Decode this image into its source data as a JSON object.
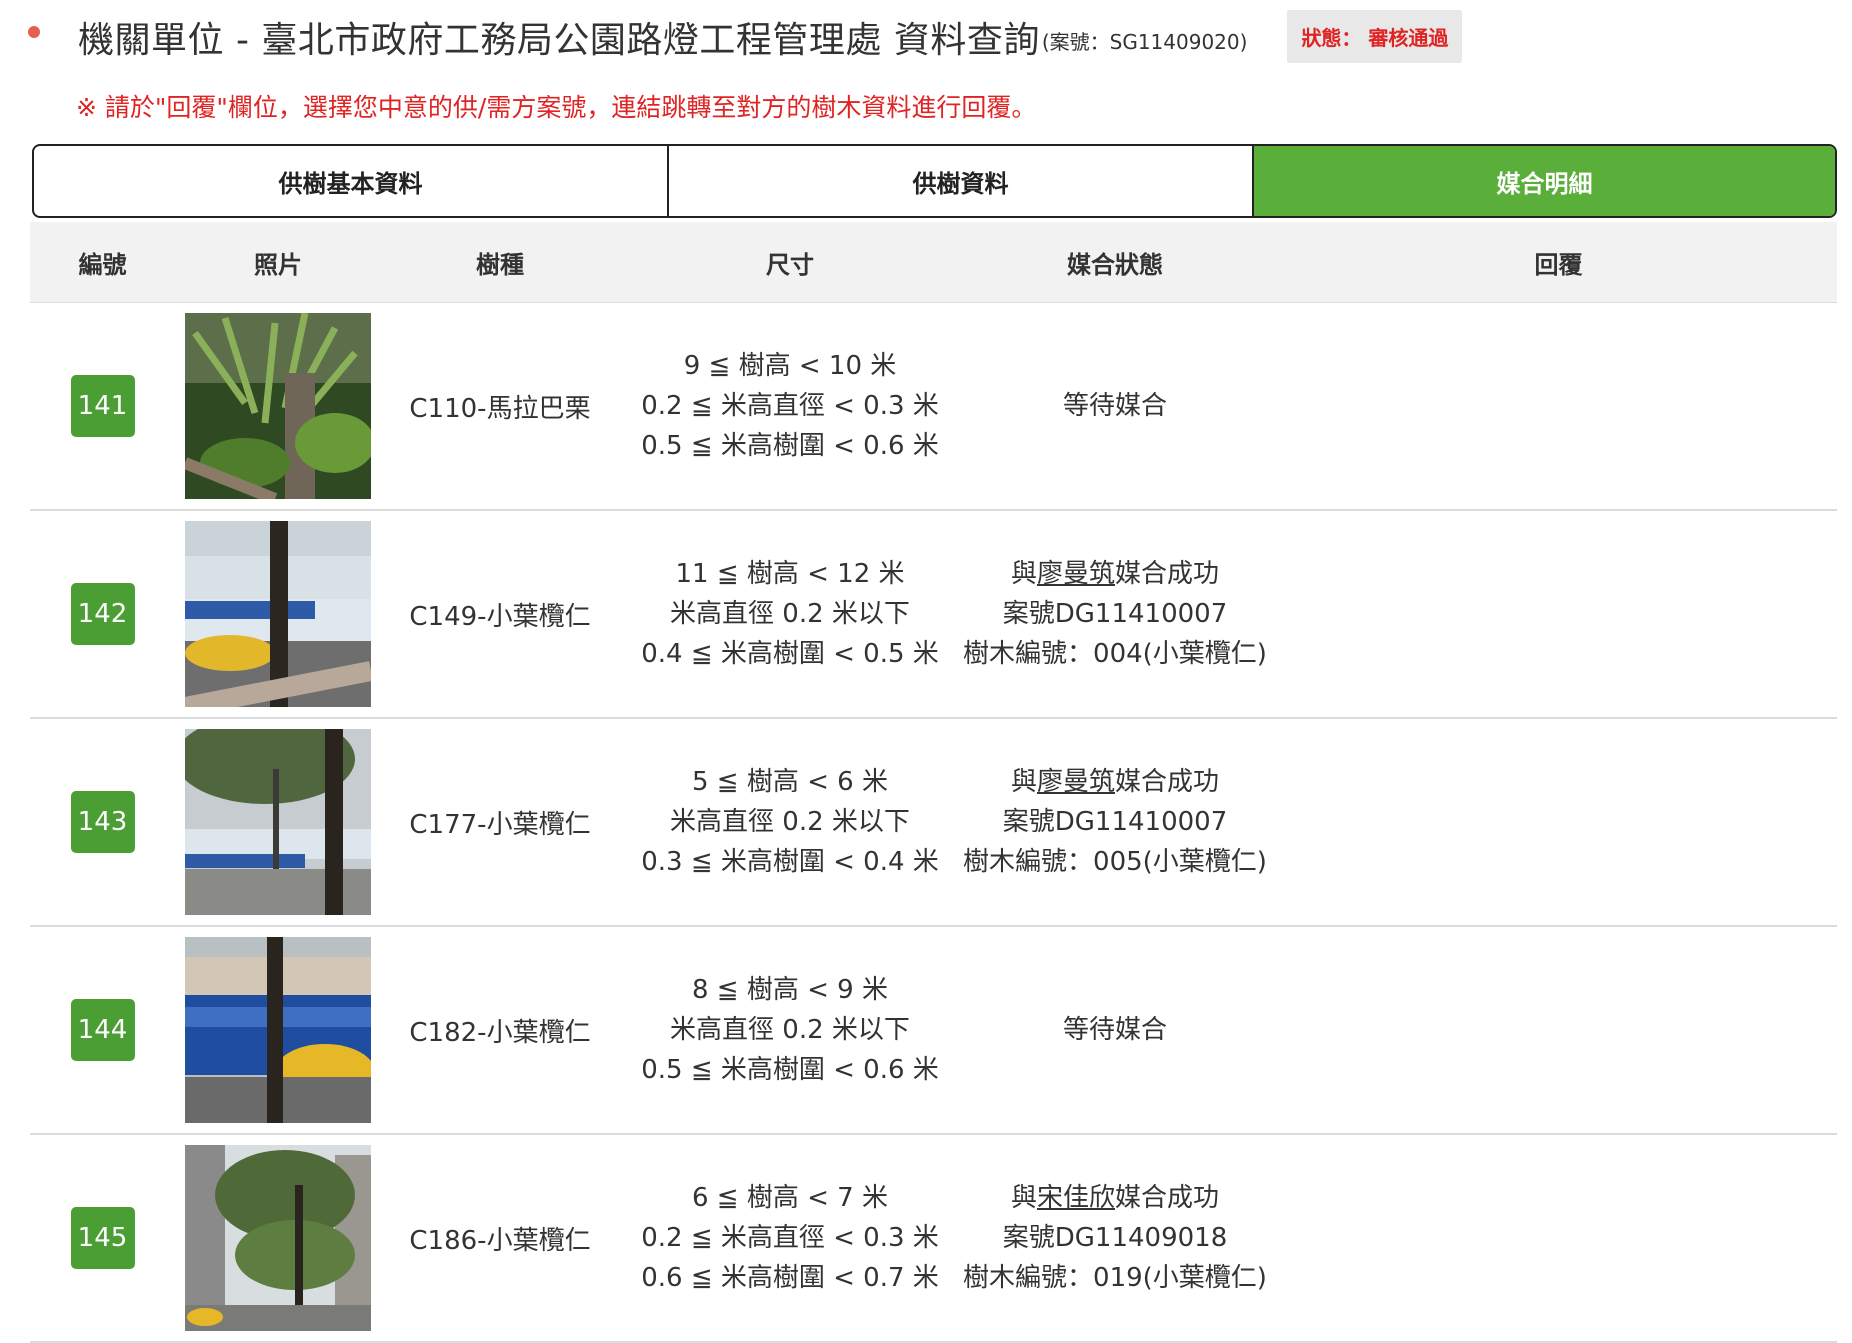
{
  "header": {
    "title": "機關單位 - 臺北市政府工務局公園路燈工程管理處 資料查詢",
    "case_no": "(案號：SG11409020)",
    "status": "狀態： 審核通過",
    "notice": "※ 請於\"回覆\"欄位，選擇您中意的供/需方案號，連結跳轉至對方的樹木資料進行回覆。"
  },
  "tabs": [
    "供樹基本資料",
    "供樹資料",
    "媒合明細"
  ],
  "active_tab": 2,
  "columns": [
    "編號",
    "照片",
    "樹種",
    "尺寸",
    "媒合狀態",
    "回覆"
  ],
  "rows": [
    {
      "no": "141",
      "species": "C110-馬拉巴栗",
      "size": [
        "9 ≦ 樹高 < 10 米",
        "0.2 ≦ 米高直徑 < 0.3 米",
        "0.5 ≦ 米高樹圍 < 0.6 米"
      ],
      "status": {
        "prefix": "",
        "name": "",
        "suffix": "等待媒合",
        "case": "",
        "tree": ""
      }
    },
    {
      "no": "142",
      "species": "C149-小葉欖仁",
      "size": [
        "11 ≦ 樹高 < 12 米",
        "米高直徑 0.2 米以下",
        "0.4 ≦ 米高樹圍 < 0.5 米"
      ],
      "status": {
        "prefix": "與",
        "name": "廖曼筑",
        "suffix": "媒合成功",
        "case": "案號DG11410007",
        "tree": "樹木編號：004(小葉欖仁)"
      }
    },
    {
      "no": "143",
      "species": "C177-小葉欖仁",
      "size": [
        "5 ≦ 樹高 < 6 米",
        "米高直徑 0.2 米以下",
        "0.3 ≦ 米高樹圍 < 0.4 米"
      ],
      "status": {
        "prefix": "與",
        "name": "廖曼筑",
        "suffix": "媒合成功",
        "case": "案號DG11410007",
        "tree": "樹木編號：005(小葉欖仁)"
      }
    },
    {
      "no": "144",
      "species": "C182-小葉欖仁",
      "size": [
        "8 ≦ 樹高 < 9 米",
        "米高直徑 0.2 米以下",
        "0.5 ≦ 米高樹圍 < 0.6 米"
      ],
      "status": {
        "prefix": "",
        "name": "",
        "suffix": "等待媒合",
        "case": "",
        "tree": ""
      }
    },
    {
      "no": "145",
      "species": "C186-小葉欖仁",
      "size": [
        "6 ≦ 樹高 < 7 米",
        "0.2 ≦ 米高直徑 < 0.3 米",
        "0.6 ≦ 米高樹圍 < 0.7 米"
      ],
      "status": {
        "prefix": "與",
        "name": "宋佳欣",
        "suffix": "媒合成功",
        "case": "案號DG11409018",
        "tree": "樹木編號：019(小葉欖仁)"
      }
    }
  ],
  "colors": {
    "accent_green": "#5aae3a",
    "badge_green": "#4a9e34",
    "alert_red": "#e02424"
  }
}
